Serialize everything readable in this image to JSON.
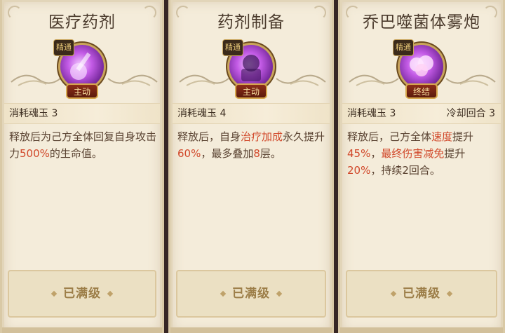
{
  "cards": [
    {
      "title": "医疗药剂",
      "grade": "精通",
      "type_tag": "主动",
      "cost": "消耗魂玉 3",
      "cooldown": "",
      "desc": [
        {
          "t": "释放后为己方全体回复自身攻击力",
          "h": false
        },
        {
          "t": "500%",
          "h": true
        },
        {
          "t": "的生命值。",
          "h": false
        }
      ],
      "button": "已满级"
    },
    {
      "title": "药剂制备",
      "grade": "精通",
      "type_tag": "主动",
      "cost": "消耗魂玉 4",
      "cooldown": "",
      "desc": [
        {
          "t": "释放后，自身",
          "h": false
        },
        {
          "t": "治疗加成",
          "h": true
        },
        {
          "t": "永久提升",
          "h": false
        },
        {
          "t": "60%",
          "h": true
        },
        {
          "t": "，最多叠加",
          "h": false
        },
        {
          "t": "8",
          "h": true
        },
        {
          "t": "层。",
          "h": false
        }
      ],
      "button": "已满级"
    },
    {
      "title": "乔巴噬菌体雾炮",
      "grade": "精通",
      "type_tag": "终结",
      "cost": "消耗魂玉 3",
      "cooldown": "冷却回合 3",
      "desc": [
        {
          "t": "释放后，己方全体",
          "h": false
        },
        {
          "t": "速度",
          "h": true
        },
        {
          "t": "提升",
          "h": false
        },
        {
          "t": "45%",
          "h": true
        },
        {
          "t": "，",
          "h": false
        },
        {
          "t": "最终伤害减免",
          "h": true
        },
        {
          "t": "提升",
          "h": false
        },
        {
          "t": "20%",
          "h": true
        },
        {
          "t": "，持续2回合。",
          "h": false
        }
      ],
      "button": "已满级"
    }
  ],
  "colors": {
    "highlight": "#d1482a",
    "text": "#5a4332",
    "orb": "#c35be6"
  }
}
